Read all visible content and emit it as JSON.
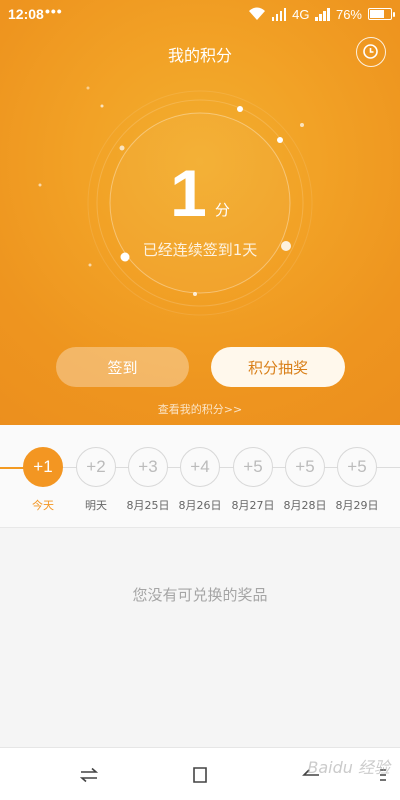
{
  "status_bar": {
    "time": "12:08",
    "dots": "•••",
    "network": "4G",
    "battery": "76%",
    "battery_level": 0.76
  },
  "header": {
    "title": "我的积分",
    "history_icon": "clock-icon"
  },
  "summary": {
    "points": "1",
    "unit": "分",
    "streak": "已经连续签到1天"
  },
  "actions": {
    "checkin_label": "签到",
    "lottery_label": "积分抽奖",
    "view_points_link": "查看我的积分>>"
  },
  "days": [
    {
      "reward": "+1",
      "label": "今天",
      "active": true
    },
    {
      "reward": "+2",
      "label": "明天",
      "active": false
    },
    {
      "reward": "+3",
      "label": "8月25日",
      "active": false
    },
    {
      "reward": "+4",
      "label": "8月26日",
      "active": false
    },
    {
      "reward": "+5",
      "label": "8月27日",
      "active": false
    },
    {
      "reward": "+5",
      "label": "8月28日",
      "active": false
    },
    {
      "reward": "+5",
      "label": "8月29日",
      "active": false
    }
  ],
  "rewards": {
    "empty_message": "您没有可兑换的奖品"
  },
  "nav": {
    "icons": [
      "switch-icon",
      "square-icon",
      "back-icon",
      "menu-icon"
    ]
  },
  "watermark": "Baidu 经验",
  "colors": {
    "accent": "#f39622",
    "header_bg": "#f2a226",
    "lottery_text": "#d9801a"
  }
}
